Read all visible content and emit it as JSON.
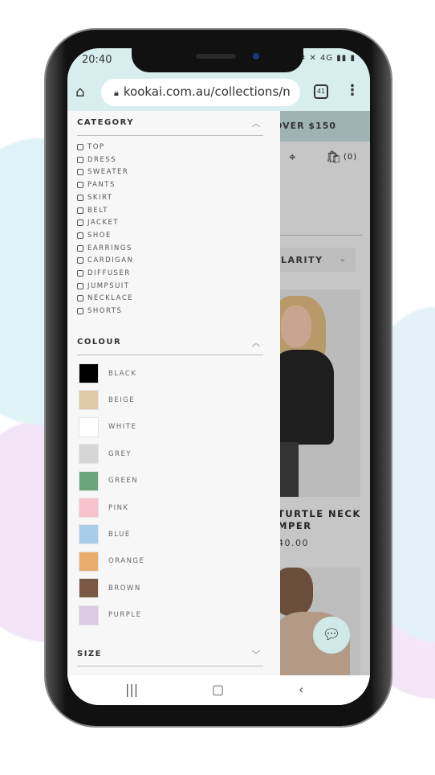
{
  "status": {
    "time": "20:40",
    "icons": "✉ ✱ ✕ 4G ▮▮ ▮"
  },
  "browser": {
    "url": "kookai.com.au/collections/n",
    "tab_count": "41"
  },
  "site": {
    "banner": "OVER $150",
    "cart": "(0)",
    "sort": "LARITY",
    "product": {
      "name_line1": "TURTLE NECK",
      "name_line2": "MPER",
      "price": "40.00"
    }
  },
  "filters": {
    "category": {
      "title": "CATEGORY",
      "items": [
        "TOP",
        "DRESS",
        "SWEATER",
        "PANTS",
        "SKIRT",
        "BELT",
        "JACKET",
        "SHOE",
        "EARRINGS",
        "CARDIGAN",
        "DIFFUSER",
        "JUMPSUIT",
        "NECKLACE",
        "SHORTS"
      ]
    },
    "colour": {
      "title": "COLOUR",
      "items": [
        {
          "label": "BLACK",
          "color": "#000000"
        },
        {
          "label": "BEIGE",
          "color": "#e0c9a6"
        },
        {
          "label": "WHITE",
          "color": "#ffffff"
        },
        {
          "label": "GREY",
          "color": "#d6d6d6"
        },
        {
          "label": "GREEN",
          "color": "#6aa57b"
        },
        {
          "label": "PINK",
          "color": "#f8c3cd"
        },
        {
          "label": "BLUE",
          "color": "#a9cde8"
        },
        {
          "label": "ORANGE",
          "color": "#e9ac6d"
        },
        {
          "label": "BROWN",
          "color": "#7b5844"
        },
        {
          "label": "PURPLE",
          "color": "#dccbe2"
        }
      ]
    },
    "size": {
      "title": "SIZE"
    }
  }
}
